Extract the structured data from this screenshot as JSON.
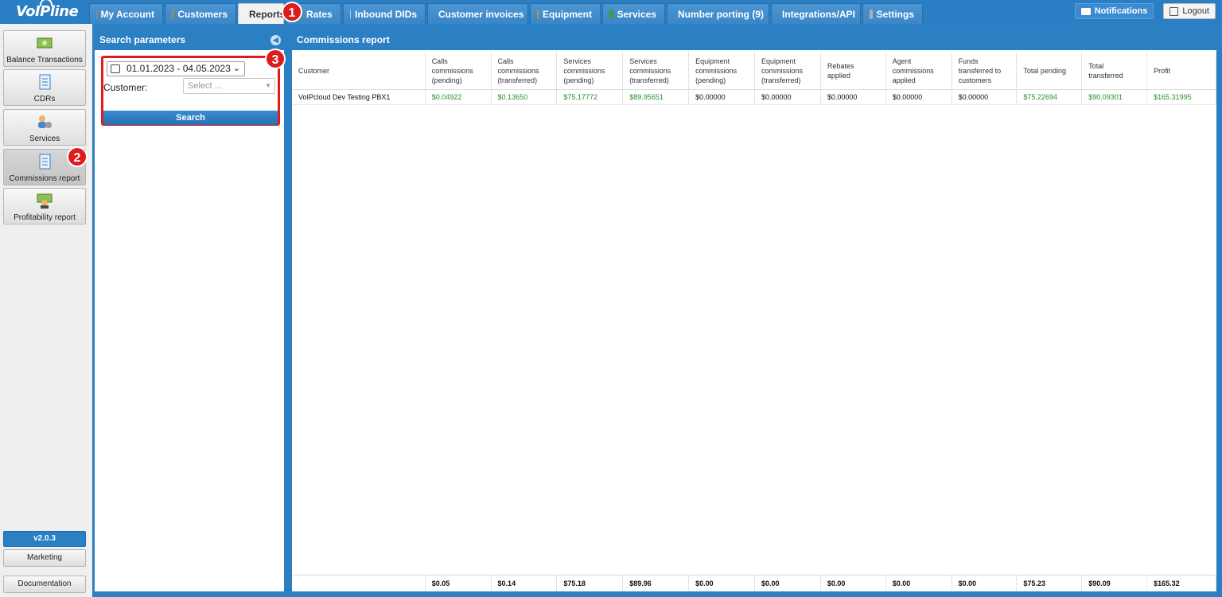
{
  "app": {
    "logo_text": "VoIPline"
  },
  "tabs": [
    {
      "label": "My Account",
      "icon": "user-icon"
    },
    {
      "label": "Customers",
      "icon": "customers-icon"
    },
    {
      "label": "Reports",
      "icon": "report-icon"
    },
    {
      "label": "Rates",
      "icon": "rates-icon"
    },
    {
      "label": "Inbound DIDs",
      "icon": "did-icon"
    },
    {
      "label": "Customer invoices",
      "icon": "coins-icon"
    },
    {
      "label": "Equipment",
      "icon": "box-icon"
    },
    {
      "label": "Services",
      "icon": "services-icon"
    },
    {
      "label": "Number porting (9)",
      "icon": "phone-icon"
    },
    {
      "label": "Integrations/API",
      "icon": "gear-icon"
    },
    {
      "label": "Settings",
      "icon": "settings-icon"
    }
  ],
  "topright": {
    "notifications": "Notifications",
    "logout": "Logout"
  },
  "leftnav": {
    "items": [
      {
        "label": "Balance Transactions"
      },
      {
        "label": "CDRs"
      },
      {
        "label": "Services"
      },
      {
        "label": "Commissions report"
      },
      {
        "label": "Profitability report"
      }
    ],
    "version": "v2.0.3",
    "marketing": "Marketing",
    "documentation": "Documentation"
  },
  "search": {
    "title": "Search parameters",
    "date_range": "01.01.2023 - 04.05.2023",
    "customer_label": "Customer:",
    "customer_placeholder": "Select ...",
    "search_button": "Search"
  },
  "report": {
    "title": "Commissions report",
    "columns": [
      "Customer",
      "Calls commissions (pending)",
      "Calls commissions (transferred)",
      "Services commissions (pending)",
      "Services commissions (transferred)",
      "Equipment commissions (pending)",
      "Equipment commissions (transferred)",
      "Rebates applied",
      "Agent commissions applied",
      "Funds transferred to customers",
      "Total pending",
      "Total transferred",
      "Profit"
    ],
    "rows": [
      [
        "VoIPcloud Dev Testing PBX1",
        "$0.04922",
        "$0.13650",
        "$75.17772",
        "$89.95651",
        "$0.00000",
        "$0.00000",
        "$0.00000",
        "$0.00000",
        "$0.00000",
        "$75.22694",
        "$90.09301",
        "$165.31995"
      ]
    ],
    "totals": [
      "",
      "$0.05",
      "$0.14",
      "$75.18",
      "$89.96",
      "$0.00",
      "$0.00",
      "$0.00",
      "$0.00",
      "$0.00",
      "$75.23",
      "$90.09",
      "$165.32"
    ]
  },
  "annotations": [
    "1",
    "2",
    "3"
  ]
}
